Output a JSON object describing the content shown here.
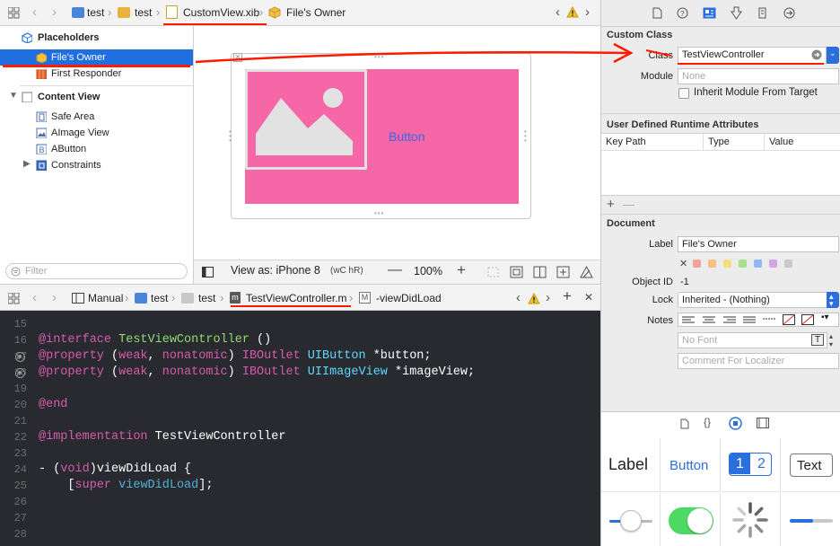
{
  "top_jumpbar": {
    "items": [
      "test",
      "test",
      "CustomView.xib",
      "File's Owner"
    ]
  },
  "outline": {
    "placeholders": "Placeholders",
    "files_owner": "File's Owner",
    "first_responder": "First Responder",
    "content_view": "Content View",
    "safe_area": "Safe Area",
    "image_view": "AImage View",
    "button": "AButton",
    "constraints": "Constraints",
    "filter_placeholder": "Filter"
  },
  "canvas": {
    "button_label": "Button",
    "view_as": "View as: iPhone 8",
    "size_class": "(wC hR)",
    "zoom": "100%"
  },
  "editor_jumpbar": {
    "items": [
      "Manual",
      "test",
      "test",
      "TestViewController.m",
      "-viewDidLoad"
    ]
  },
  "code": {
    "lines": [
      {
        "n": "15",
        "t": ""
      },
      {
        "n": "16",
        "t": "@interface TestViewController ()"
      },
      {
        "n": "17",
        "t": "@property (weak, nonatomic) IBOutlet UIButton *button;"
      },
      {
        "n": "18",
        "t": "@property (weak, nonatomic) IBOutlet UIImageView *imageView;"
      },
      {
        "n": "19",
        "t": ""
      },
      {
        "n": "20",
        "t": "@end"
      },
      {
        "n": "21",
        "t": ""
      },
      {
        "n": "22",
        "t": "@implementation TestViewController"
      },
      {
        "n": "23",
        "t": ""
      },
      {
        "n": "24",
        "t": "- (void)viewDidLoad {"
      },
      {
        "n": "25",
        "t": "    [super viewDidLoad];"
      },
      {
        "n": "26",
        "t": ""
      },
      {
        "n": "27",
        "t": ""
      },
      {
        "n": "28",
        "t": ""
      }
    ]
  },
  "inspector": {
    "custom_class_title": "Custom Class",
    "class_label": "Class",
    "class_value": "TestViewController",
    "module_label": "Module",
    "module_placeholder": "None",
    "inherit_label": "Inherit Module From Target",
    "runtime_title": "User Defined Runtime Attributes",
    "col_key": "Key Path",
    "col_type": "Type",
    "col_value": "Value",
    "document_title": "Document",
    "label_label": "Label",
    "label_value": "File's Owner",
    "object_id_label": "Object ID",
    "object_id_value": "-1",
    "lock_label": "Lock",
    "lock_value": "Inherited - (Nothing)",
    "notes_label": "Notes",
    "font_placeholder": "No Font",
    "comment_placeholder": "Comment For Localizer"
  },
  "library": {
    "label": "Label",
    "button": "Button",
    "seg1": "1",
    "seg2": "2",
    "text": "Text"
  },
  "colors": {
    "pink_view": "#f667a8",
    "selection": "#1f6fe0",
    "annotation": "#ff1a00",
    "code_bg": "#292a30"
  }
}
